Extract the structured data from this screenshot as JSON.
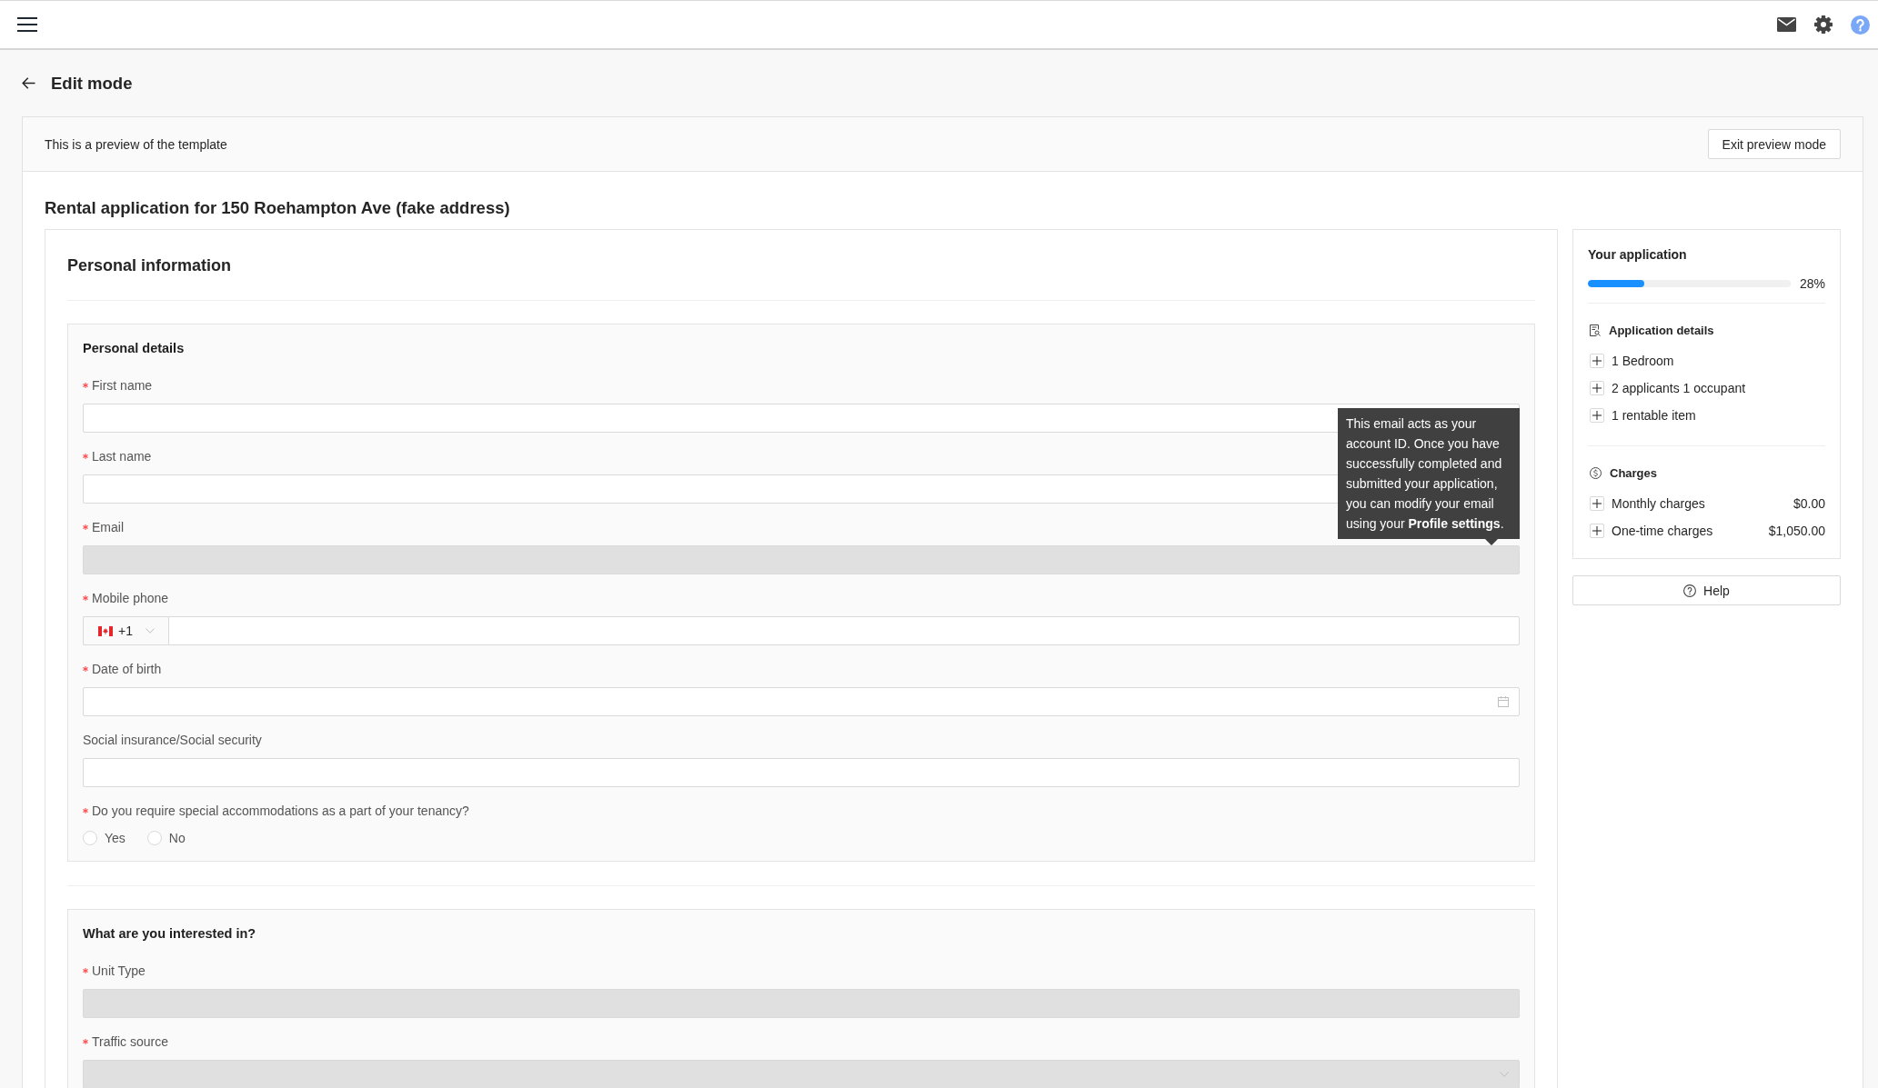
{
  "header": {
    "title": "Edit mode"
  },
  "preview_banner": {
    "text": "This is a preview of the template",
    "button": "Exit preview mode"
  },
  "application": {
    "title": "Rental application for 150 Roehampton Ave (fake address)",
    "form": {
      "title": "Personal information",
      "sections": [
        {
          "title": "Personal details",
          "fields": [
            {
              "kind": "text",
              "label": "First name",
              "required": true,
              "disabled": false
            },
            {
              "kind": "text",
              "label": "Last name",
              "required": true,
              "disabled": false
            },
            {
              "kind": "text",
              "label": "Email",
              "required": true,
              "disabled": true
            },
            {
              "kind": "phone",
              "label": "Mobile phone",
              "required": true,
              "disabled": false,
              "country_code": "+1"
            },
            {
              "kind": "date",
              "label": "Date of birth",
              "required": true,
              "disabled": false
            },
            {
              "kind": "text",
              "label": "Social insurance/Social security",
              "required": false,
              "disabled": false
            },
            {
              "kind": "radio",
              "label": "Do you require special accommodations as a part of your tenancy?",
              "required": true,
              "options": [
                {
                  "label": "Yes",
                  "selected": false
                },
                {
                  "label": "No",
                  "selected": false
                }
              ]
            }
          ]
        },
        {
          "title": "What are you interested in?",
          "fields": [
            {
              "kind": "text",
              "label": "Unit Type",
              "required": true,
              "disabled": true
            },
            {
              "kind": "select",
              "label": "Traffic source",
              "required": true,
              "disabled": true
            }
          ]
        }
      ]
    },
    "sidebar": {
      "title": "Your application",
      "progress": {
        "level": 0.28,
        "reading": "28%"
      },
      "details": {
        "title": "Application details",
        "items": [
          {
            "label": "1 Bedroom",
            "expanded": false
          },
          {
            "label": "2 applicants 1 occupant",
            "expanded": false
          },
          {
            "label": "1 rentable item",
            "expanded": false
          }
        ]
      },
      "charges": {
        "title": "Charges",
        "items": [
          {
            "label": "Monthly charges",
            "amount": "$0.00",
            "expanded": false
          },
          {
            "label": "One-time charges",
            "amount": "$1,050.00",
            "expanded": false
          }
        ]
      },
      "help_button": "Help"
    }
  },
  "tooltip": {
    "text": "This email acts as your account ID. Once you have successfully completed and submitted your application, you can modify your email using your **Profile settings**."
  }
}
